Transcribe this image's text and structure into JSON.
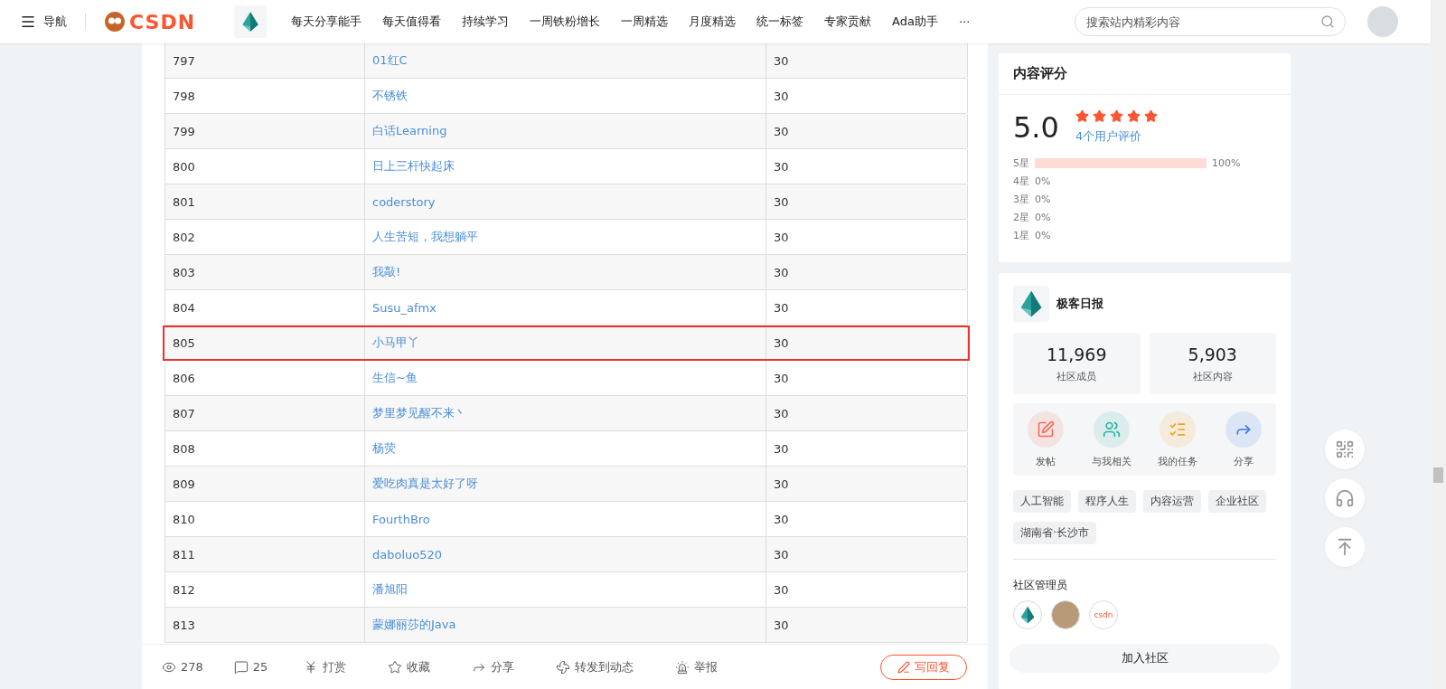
{
  "header": {
    "menu_label": "导航",
    "logo_text": "CSDN",
    "nav": [
      "每天分享能手",
      "每天值得看",
      "持续学习",
      "一周铁粉增长",
      "一周精选",
      "月度精选",
      "统一标签",
      "专家贡献",
      "Ada助手"
    ],
    "more": "···",
    "search": {
      "placeholder": "搜索站内精彩内容"
    }
  },
  "table": {
    "rows": [
      {
        "cells": [
          "797",
          "01红C",
          "30"
        ],
        "highlighted": false
      },
      {
        "cells": [
          "798",
          "不锈铁",
          "30"
        ],
        "highlighted": false
      },
      {
        "cells": [
          "799",
          "白话Learning",
          "30"
        ],
        "highlighted": false
      },
      {
        "cells": [
          "800",
          "日上三杆快起床",
          "30"
        ],
        "highlighted": false
      },
      {
        "cells": [
          "801",
          "coderstory",
          "30"
        ],
        "highlighted": false
      },
      {
        "cells": [
          "802",
          "人生苦短，我想躺平",
          "30"
        ],
        "highlighted": false
      },
      {
        "cells": [
          "803",
          "我敲!",
          "30"
        ],
        "highlighted": false
      },
      {
        "cells": [
          "804",
          "Susu_afmx",
          "30"
        ],
        "highlighted": false
      },
      {
        "cells": [
          "805",
          "小马甲丫",
          "30"
        ],
        "highlighted": true
      },
      {
        "cells": [
          "806",
          "生信~鱼",
          "30"
        ],
        "highlighted": false
      },
      {
        "cells": [
          "807",
          "梦里梦见醒不来丶",
          "30"
        ],
        "highlighted": false
      },
      {
        "cells": [
          "808",
          "杨荧",
          "30"
        ],
        "highlighted": false
      },
      {
        "cells": [
          "809",
          "爱吃肉真是太好了呀",
          "30"
        ],
        "highlighted": false
      },
      {
        "cells": [
          "810",
          "FourthBro",
          "30"
        ],
        "highlighted": false
      },
      {
        "cells": [
          "811",
          "daboluo520",
          "30"
        ],
        "highlighted": false
      },
      {
        "cells": [
          "812",
          "潘旭阳",
          "30"
        ],
        "highlighted": false
      },
      {
        "cells": [
          "813",
          "蒙娜丽莎的Java",
          "30"
        ],
        "highlighted": false
      }
    ]
  },
  "action_bar": {
    "items": [
      {
        "kind": "views",
        "label": "278"
      },
      {
        "kind": "comments",
        "label": "25"
      },
      {
        "kind": "reward",
        "label": "打赏"
      },
      {
        "kind": "favorite",
        "label": "收藏"
      },
      {
        "kind": "share",
        "label": "分享"
      },
      {
        "kind": "repost",
        "label": "转发到动态"
      },
      {
        "kind": "report",
        "label": "举报"
      }
    ],
    "reply_button": "写回复"
  },
  "rating": {
    "title": "内容评分",
    "score": "5.0",
    "stars": 5,
    "reviews_link": "4个用户评价",
    "rows": [
      {
        "label": "5星",
        "level": 1,
        "percent": "100%"
      },
      {
        "label": "4星",
        "percent": "0%"
      },
      {
        "label": "3星",
        "percent": "0%"
      },
      {
        "label": "2星",
        "percent": "0%"
      },
      {
        "label": "1星",
        "percent": "0%"
      }
    ]
  },
  "community": {
    "name": "极客日报",
    "stats": [
      {
        "value": "11,969",
        "label": "社区成员"
      },
      {
        "value": "5,903",
        "label": "社区内容"
      }
    ],
    "actions": [
      {
        "kind": "post",
        "label": "发帖",
        "color": "#f86c5c"
      },
      {
        "kind": "related",
        "label": "与我相关",
        "color": "#2fb3a8"
      },
      {
        "kind": "tasks",
        "label": "我的任务",
        "color": "#f3a31c"
      },
      {
        "kind": "share",
        "label": "分享",
        "color": "#3a79e8"
      }
    ],
    "tags": [
      "人工智能",
      "程序人生",
      "内容运营",
      "企业社区",
      "湖南省·长沙市"
    ],
    "admins_title": "社区管理员",
    "admins": [
      {
        "kind": "crystal"
      },
      {
        "kind": "photo"
      },
      {
        "kind": "logo",
        "text": "csdn"
      }
    ],
    "join_button": "加入社区"
  }
}
